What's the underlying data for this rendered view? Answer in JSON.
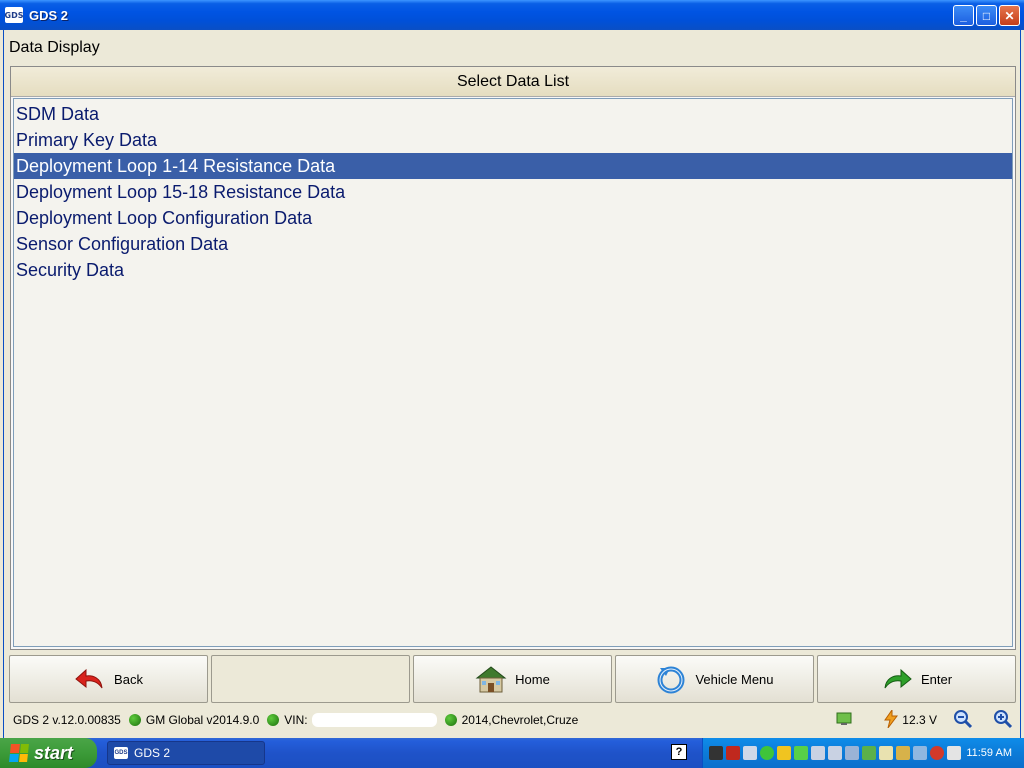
{
  "window": {
    "title": "GDS 2",
    "icon_label": "GDS",
    "minimize": "_",
    "maximize": "□",
    "close": "✕"
  },
  "screen_title": "Data Display",
  "list_panel": {
    "header": "Select Data List",
    "items": [
      {
        "label": "SDM Data",
        "selected": false
      },
      {
        "label": "Primary Key Data",
        "selected": false
      },
      {
        "label": "Deployment Loop 1-14 Resistance Data",
        "selected": true
      },
      {
        "label": "Deployment Loop 15-18 Resistance Data",
        "selected": false
      },
      {
        "label": "Deployment Loop Configuration Data",
        "selected": false
      },
      {
        "label": "Sensor Configuration Data",
        "selected": false
      },
      {
        "label": "Security Data",
        "selected": false
      }
    ]
  },
  "buttons": {
    "back": "Back",
    "home": "Home",
    "vehicle_menu": "Vehicle Menu",
    "enter": "Enter"
  },
  "status": {
    "version": "GDS 2 v.12.0.00835",
    "database": "GM Global v2014.9.0",
    "vin_label": "VIN:",
    "vehicle": "2014,Chevrolet,Cruze",
    "voltage": "12.3 V"
  },
  "taskbar": {
    "start_label": "start",
    "task_label": "GDS 2",
    "help_glyph": "?",
    "clock": "11:59 AM"
  },
  "colors": {
    "selection": "#3a5fa8",
    "list_text": "#0a1b6e",
    "status_ok": "#2e9a1a",
    "titlebar": "#0054e3"
  }
}
